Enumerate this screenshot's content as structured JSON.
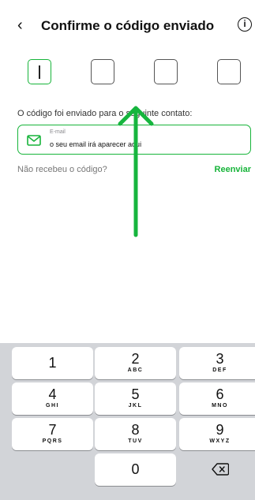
{
  "header": {
    "back_icon": "‹",
    "title": "Confirme o código enviado",
    "info_icon": "i"
  },
  "code": {
    "digit_count": 4,
    "active_index": 0
  },
  "message": {
    "sent_text": "O código foi enviado para o seguinte contato:"
  },
  "contact": {
    "icon": "mail-icon",
    "label": "E-mail",
    "value": "o seu email irá aparecer aqui"
  },
  "resend": {
    "question": "Não recebeu o código?",
    "action": "Reenviar"
  },
  "keyboard": {
    "keys": [
      {
        "num": "1",
        "letters": ""
      },
      {
        "num": "2",
        "letters": "ABC"
      },
      {
        "num": "3",
        "letters": "DEF"
      },
      {
        "num": "4",
        "letters": "GHI"
      },
      {
        "num": "5",
        "letters": "JKL"
      },
      {
        "num": "6",
        "letters": "MNO"
      },
      {
        "num": "7",
        "letters": "PQRS"
      },
      {
        "num": "8",
        "letters": "TUV"
      },
      {
        "num": "9",
        "letters": "WXYZ"
      },
      {
        "num": "0",
        "letters": ""
      }
    ],
    "delete_icon": "⌫"
  },
  "colors": {
    "accent": "#17b43a",
    "keyboard_bg": "#d2d4d8"
  }
}
